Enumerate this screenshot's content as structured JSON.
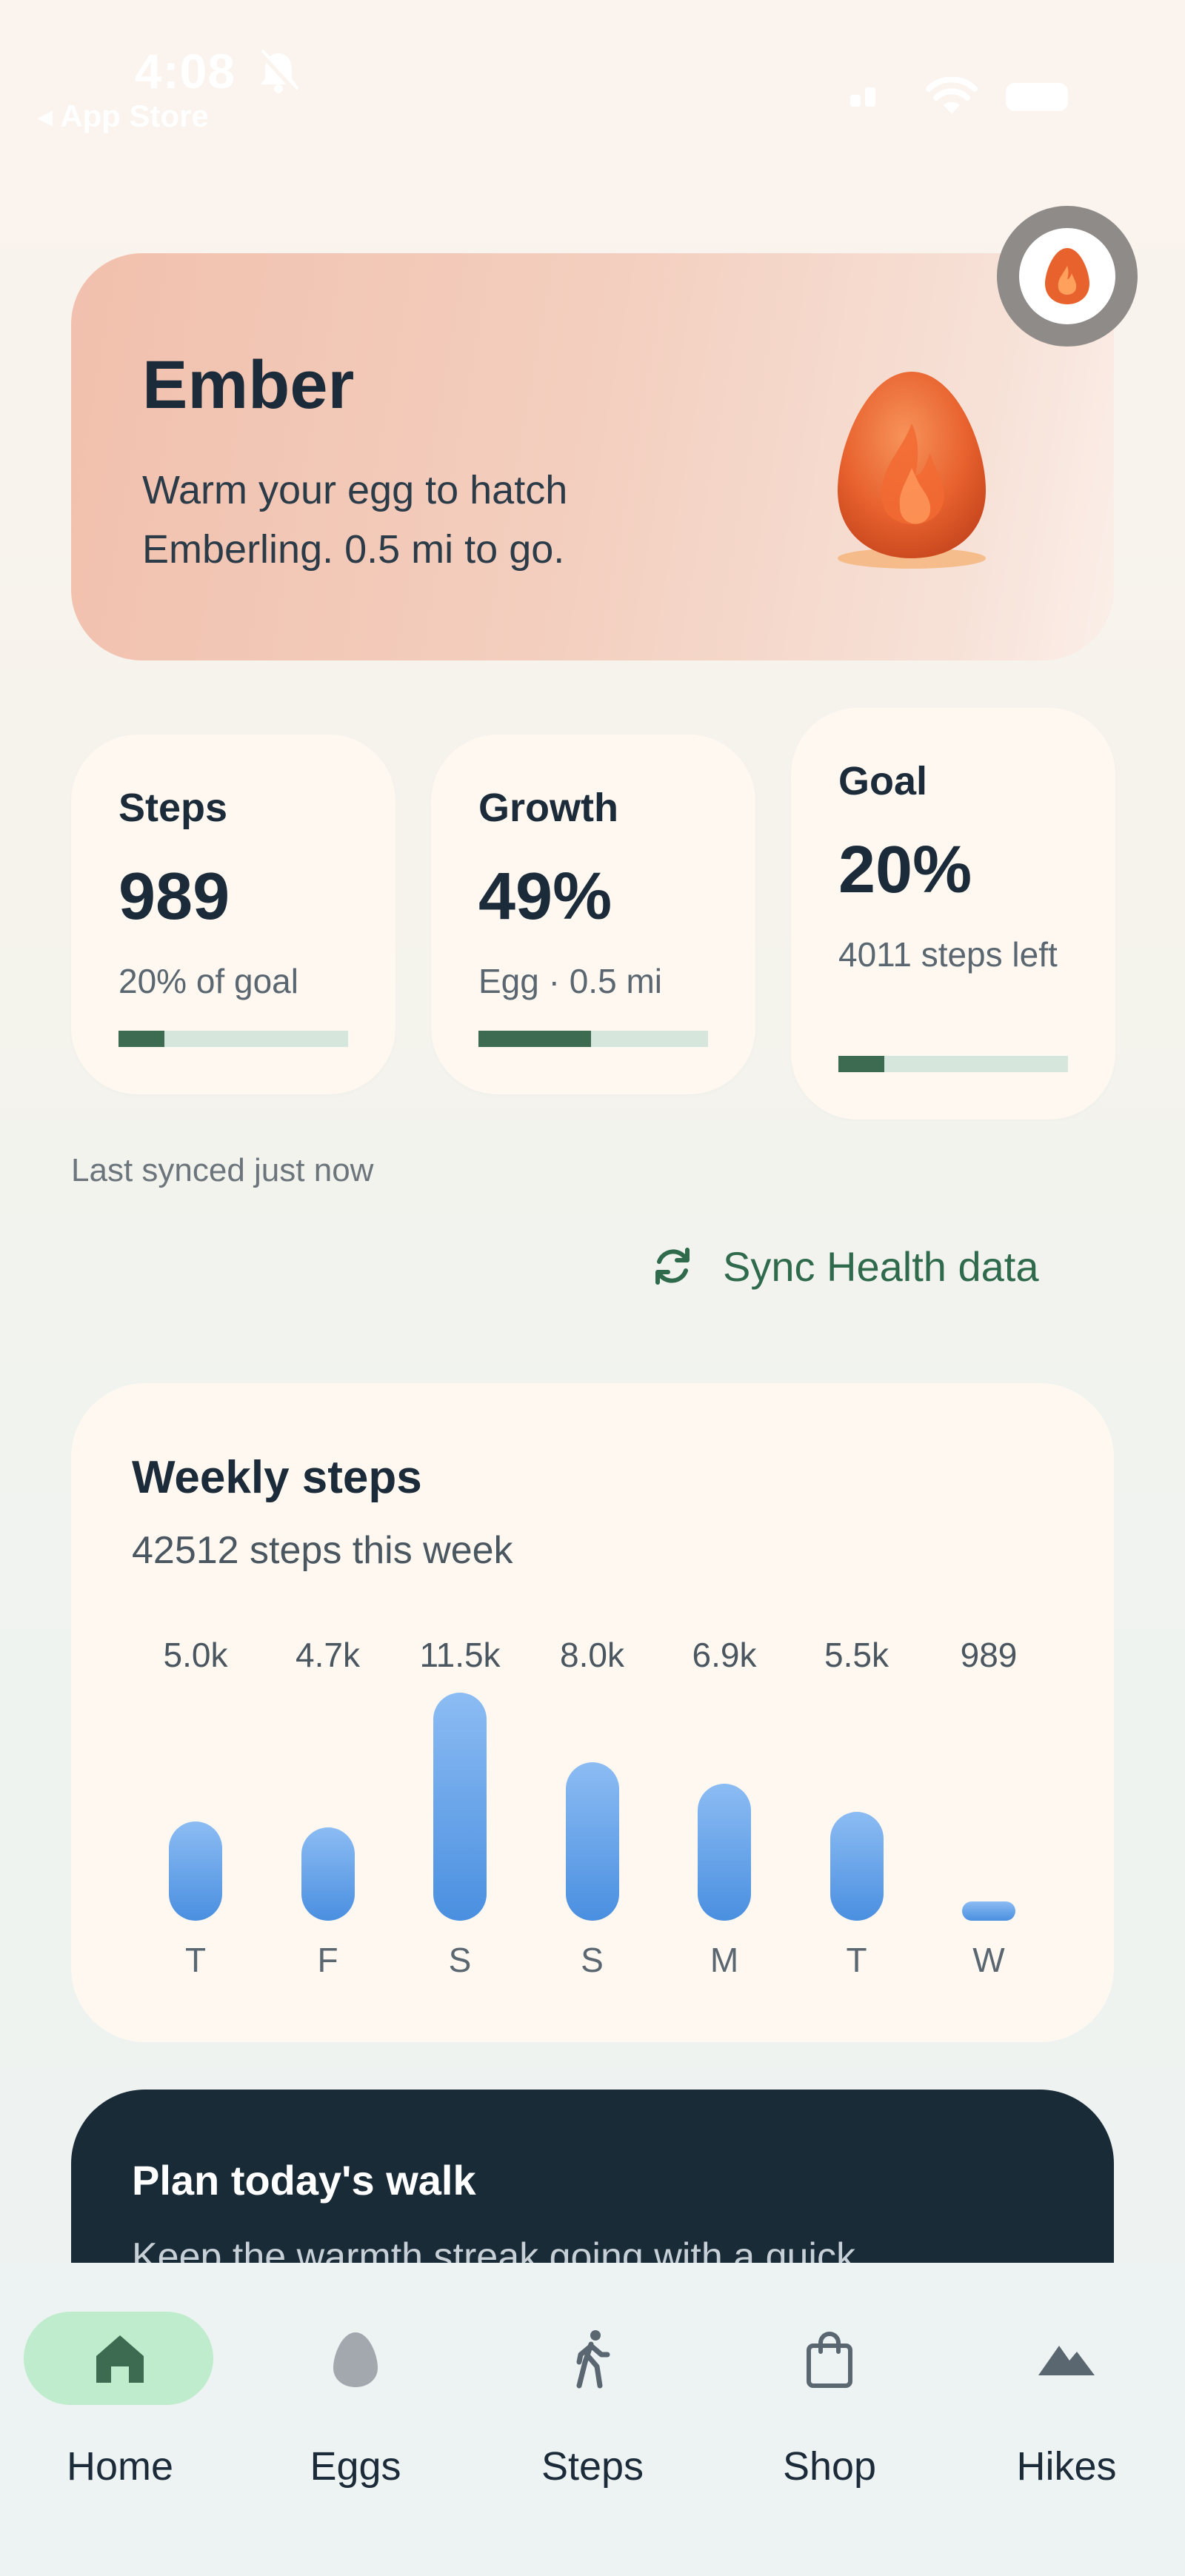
{
  "status_bar": {
    "time": "4:08",
    "back_label": "◂ App Store"
  },
  "hero": {
    "title": "Ember",
    "subtitle": "Warm your egg to hatch Emberling. 0.5 mi to go."
  },
  "stats": [
    {
      "label": "Steps",
      "value": "989",
      "note": "20% of goal",
      "progress": 0.2
    },
    {
      "label": "Growth",
      "value": "49%",
      "note": "Egg · 0.5 mi",
      "progress": 0.49
    },
    {
      "label": "Goal",
      "value": "20%",
      "note": "4011 steps left",
      "progress": 0.2
    }
  ],
  "sync": {
    "last_synced": "Last synced just now",
    "button_label": "Sync Health data"
  },
  "weekly": {
    "title": "Weekly steps",
    "subtitle": "42512 steps this week"
  },
  "chart_data": {
    "type": "bar",
    "categories": [
      "T",
      "F",
      "S",
      "S",
      "M",
      "T",
      "W"
    ],
    "values": [
      5000,
      4700,
      11500,
      8000,
      6900,
      5500,
      989
    ],
    "value_labels": [
      "5.0k",
      "4.7k",
      "11.5k",
      "8.0k",
      "6.9k",
      "5.5k",
      "989"
    ],
    "title": "Weekly steps",
    "xlabel": "",
    "ylabel": "",
    "ylim": [
      0,
      11500
    ],
    "grid": false
  },
  "plan": {
    "title": "Plan today's walk",
    "subtitle": "Keep the warmth streak going with a quick"
  },
  "tabs": [
    {
      "label": "Home",
      "icon": "home-icon",
      "active": true
    },
    {
      "label": "Eggs",
      "icon": "egg-icon",
      "active": false
    },
    {
      "label": "Steps",
      "icon": "walking-icon",
      "active": false
    },
    {
      "label": "Shop",
      "icon": "shopping-bag-icon",
      "active": false
    },
    {
      "label": "Hikes",
      "icon": "mountain-icon",
      "active": false
    }
  ],
  "colors": {
    "accent_green": "#2f6a4d",
    "progress_fill": "#3c6b52",
    "progress_track": "#d6e6dc",
    "bar_top": "#8cbcf3",
    "bar_bottom": "#4a8fe0",
    "plan_background": "#1a2b38",
    "active_tab_pill": "#bfeccc"
  }
}
